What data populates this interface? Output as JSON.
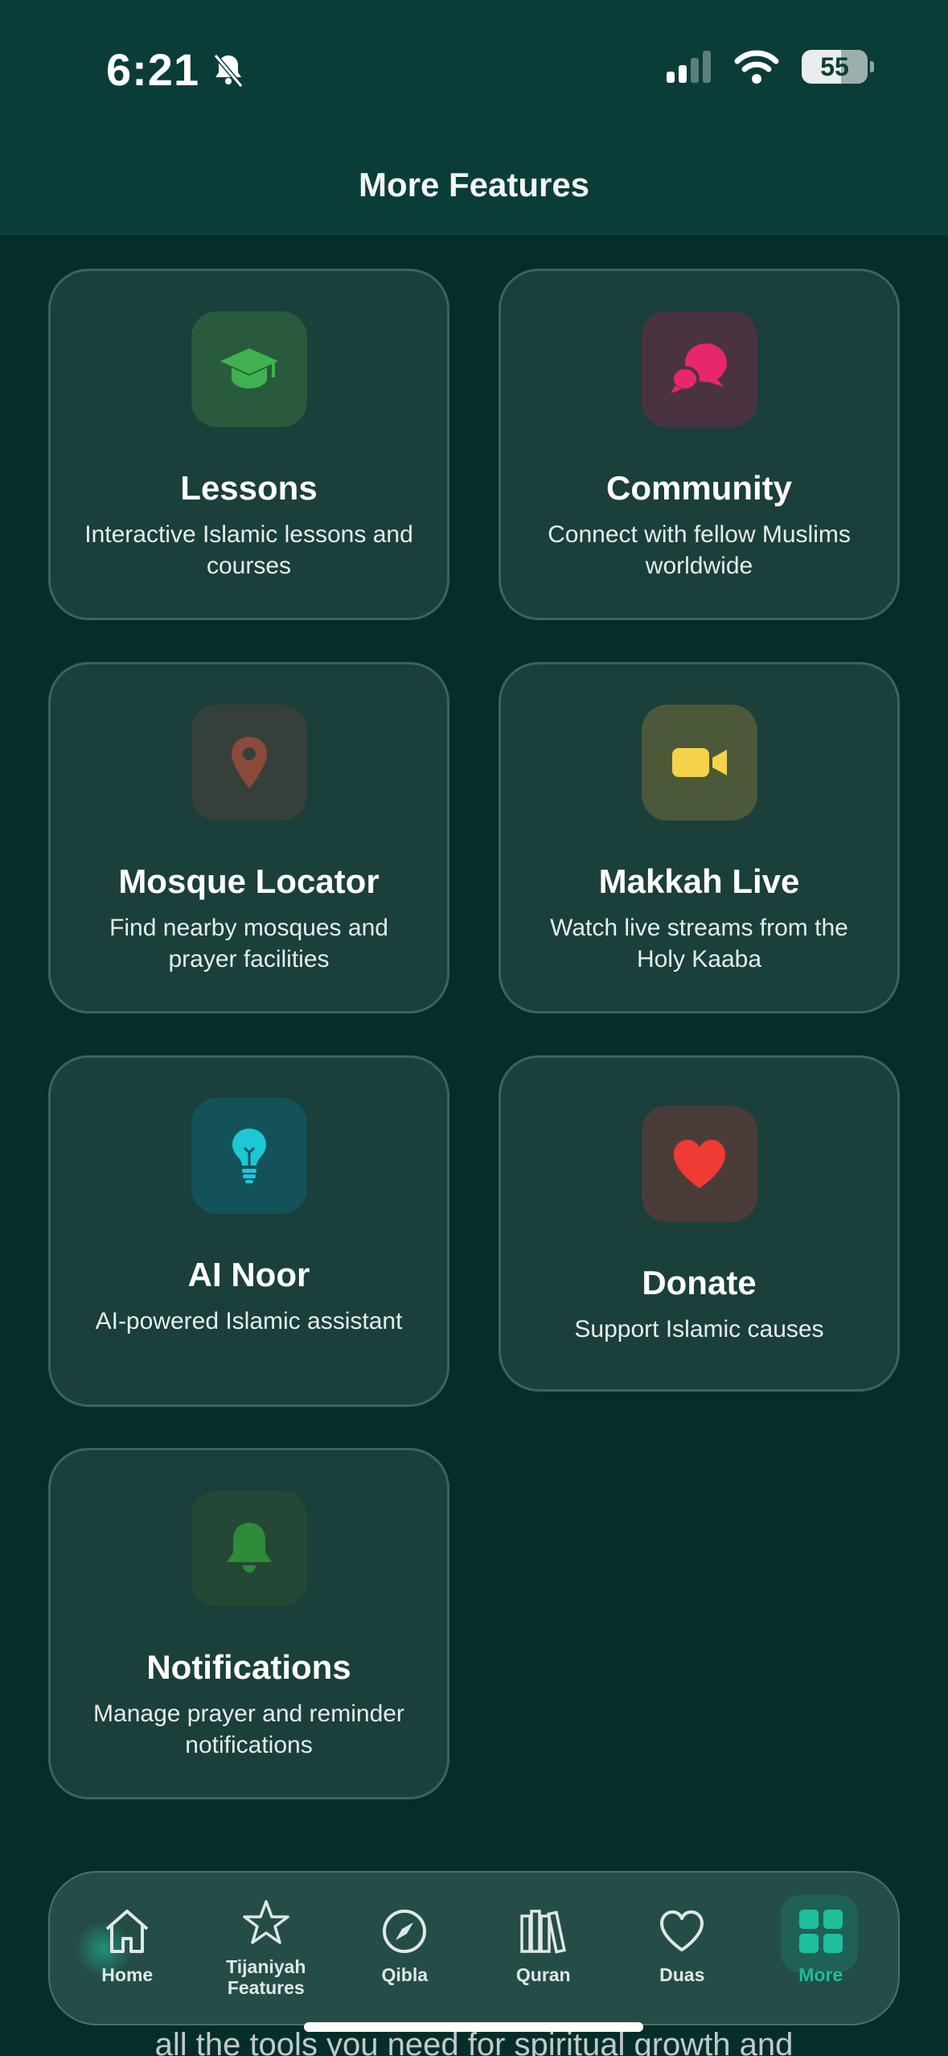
{
  "status_bar": {
    "time": "6:21",
    "battery": "55"
  },
  "header": {
    "title": "More Features"
  },
  "features": [
    {
      "title": "Lessons",
      "description": "Interactive Islamic lessons and courses",
      "icon": "graduation-cap-icon",
      "color": "#3fb24f"
    },
    {
      "title": "Community",
      "description": "Connect with fellow Muslims worldwide",
      "icon": "chat-bubbles-icon",
      "color": "#e8266d"
    },
    {
      "title": "Mosque Locator",
      "description": "Find nearby mosques and prayer facilities",
      "icon": "map-pin-icon",
      "color": "#8a4a3a"
    },
    {
      "title": "Makkah Live",
      "description": "Watch live streams from the Holy Kaaba",
      "icon": "video-camera-icon",
      "color": "#f5d24a"
    },
    {
      "title": "AI Noor",
      "description": "AI-powered Islamic assistant",
      "icon": "lightbulb-icon",
      "color": "#1cc7d6"
    },
    {
      "title": "Donate",
      "description": "Support Islamic causes",
      "icon": "heart-icon",
      "color": "#ef3b33"
    },
    {
      "title": "Notifications",
      "description": "Manage prayer and reminder notifications",
      "icon": "bell-icon",
      "color": "#2f8a3a"
    }
  ],
  "background_text": "all the tools you need for spiritual growth and",
  "tabbar": {
    "tabs": [
      {
        "label": "Home",
        "icon": "home-icon"
      },
      {
        "label": "Tijaniyah Features",
        "icon": "star-icon"
      },
      {
        "label": "Qibla",
        "icon": "compass-icon"
      },
      {
        "label": "Quran",
        "icon": "books-icon"
      },
      {
        "label": "Duas",
        "icon": "heart-outline-icon"
      },
      {
        "label": "More",
        "icon": "grid-icon",
        "active": true
      }
    ],
    "active_color": "#1fbf9e"
  }
}
